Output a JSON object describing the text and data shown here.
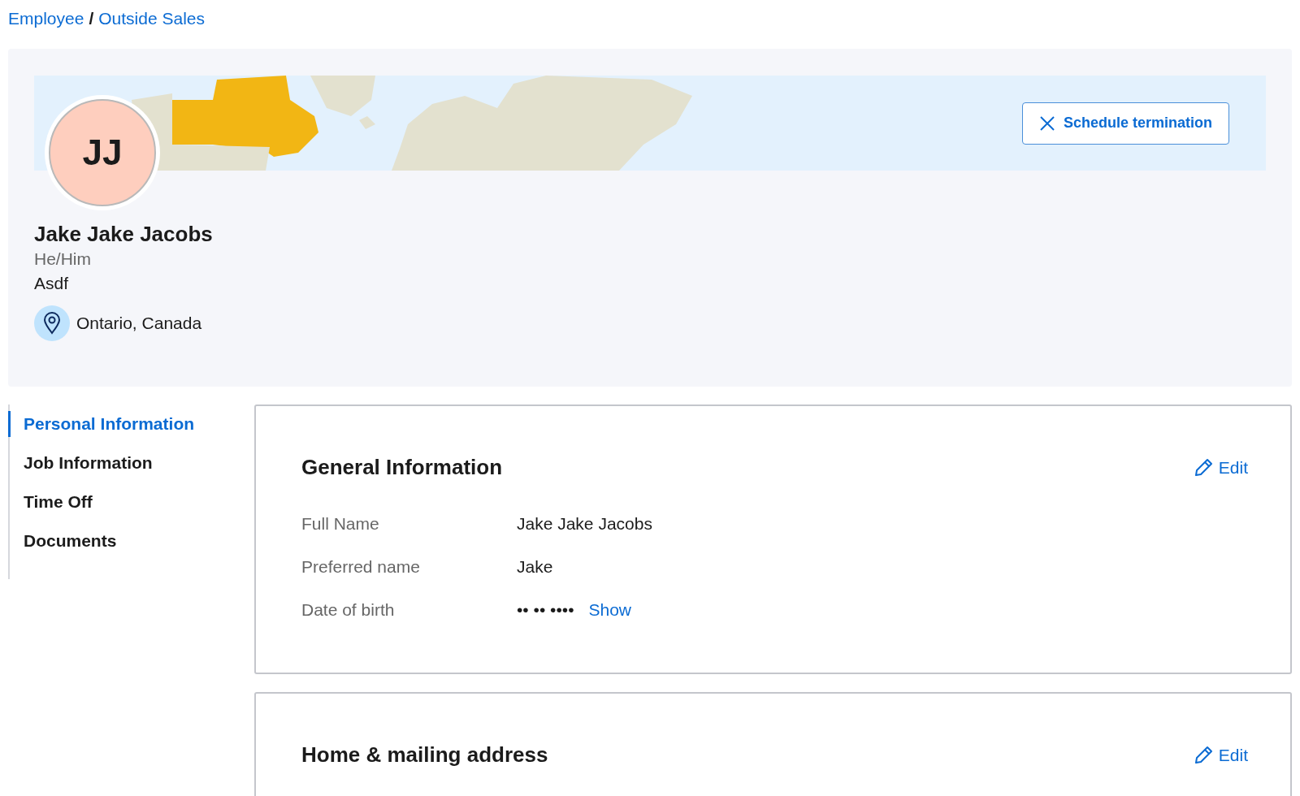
{
  "breadcrumb": {
    "items": [
      "Employee",
      "Outside Sales"
    ],
    "separator": "/"
  },
  "profile": {
    "initials": "JJ",
    "name": "Jake Jake Jacobs",
    "pronouns": "He/Him",
    "subtitle": "Asdf",
    "location": "Ontario, Canada",
    "action_button": "Schedule termination"
  },
  "nav": [
    {
      "label": "Personal Information",
      "selected": true
    },
    {
      "label": "Job Information",
      "selected": false
    },
    {
      "label": "Time Off",
      "selected": false
    },
    {
      "label": "Documents",
      "selected": false
    }
  ],
  "sections": [
    {
      "title": "General Information",
      "edit": "Edit",
      "fields": [
        {
          "label": "Full Name",
          "value": "Jake Jake Jacobs"
        },
        {
          "label": "Preferred name",
          "value": "Jake"
        },
        {
          "label": "Date of birth",
          "value": "•• •• ••••",
          "action": "Show"
        }
      ]
    },
    {
      "title": "Home & mailing address",
      "edit": "Edit"
    }
  ]
}
